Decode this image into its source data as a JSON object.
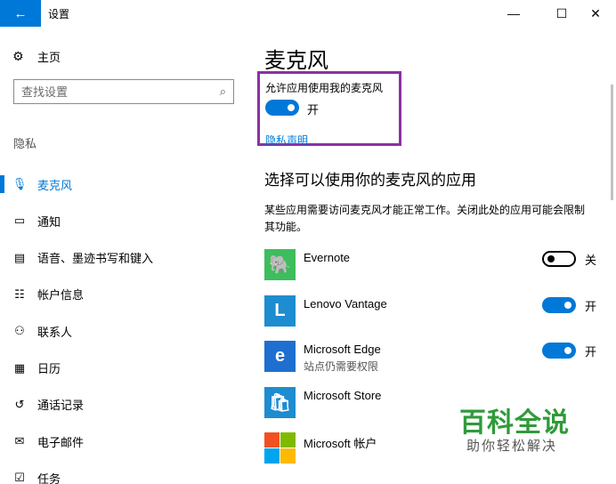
{
  "window": {
    "title": "设置",
    "back_icon": "back-arrow-icon",
    "minimize_glyph": "—",
    "maximize_glyph": "☐",
    "close_glyph": "✕"
  },
  "nav": {
    "home_label": "主页",
    "search_placeholder": "查找设置",
    "section_label": "隐私",
    "items": [
      {
        "label": "麦克风",
        "icon": "microphone-icon",
        "glyph": "🎙",
        "active": true
      },
      {
        "label": "通知",
        "icon": "notification-icon",
        "glyph": "▭",
        "active": false
      },
      {
        "label": "语音、墨迹书写和键入",
        "icon": "clipboard-icon",
        "glyph": "▤",
        "active": false
      },
      {
        "label": "帐户信息",
        "icon": "account-info-icon",
        "glyph": "☷",
        "active": false
      },
      {
        "label": "联系人",
        "icon": "contacts-icon",
        "glyph": "⚇",
        "active": false
      },
      {
        "label": "日历",
        "icon": "calendar-icon",
        "glyph": "▦",
        "active": false
      },
      {
        "label": "通话记录",
        "icon": "call-history-icon",
        "glyph": "↺",
        "active": false
      },
      {
        "label": "电子邮件",
        "icon": "email-icon",
        "glyph": "✉",
        "active": false
      },
      {
        "label": "任务",
        "icon": "tasks-icon",
        "glyph": "☑",
        "active": false
      }
    ]
  },
  "main": {
    "title": "麦克风",
    "allow_label": "允许应用使用我的麦克风",
    "allow_state": "开",
    "allow_on": true,
    "privacy_link": "隐私声明",
    "subhead": "选择可以使用你的麦克风的应用",
    "description": "某些应用需要访问麦克风才能正常工作。关闭此处的应用可能会限制其功能。",
    "apps": [
      {
        "name": "Evernote",
        "sub": "",
        "state": "关",
        "on": false,
        "color": "#3ebd5c",
        "glyph": "🐘"
      },
      {
        "name": "Lenovo Vantage",
        "sub": "",
        "state": "开",
        "on": true,
        "color": "#1e8cd0",
        "glyph": "L"
      },
      {
        "name": "Microsoft Edge",
        "sub": "站点仍需要权限",
        "state": "开",
        "on": true,
        "color": "#1e6fd0",
        "glyph": "e"
      },
      {
        "name": "Microsoft Store",
        "sub": "",
        "state": "",
        "on": true,
        "color": "#1e8cd0",
        "glyph": "🛍"
      },
      {
        "name": "Microsoft 帐户",
        "sub": "",
        "state": "",
        "on": true,
        "color": "#f25022",
        "glyph": ""
      }
    ]
  },
  "watermark": {
    "main": "百科全说",
    "sub": "助你轻松解决"
  },
  "colors": {
    "accent": "#0078d7",
    "highlight_box": "#8e2fa4",
    "watermark_green": "#2f9b3a"
  }
}
